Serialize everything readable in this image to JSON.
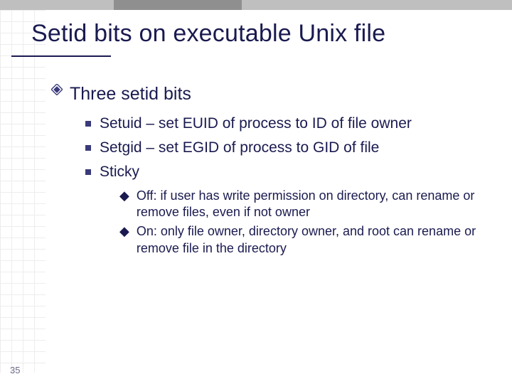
{
  "page_number": "35",
  "title": "Setid bits on executable Unix file",
  "level1": {
    "heading": "Three setid bits"
  },
  "level2": [
    {
      "text": "Setuid – set EUID of process to ID of file owner"
    },
    {
      "text": "Setgid – set EGID of process to GID of file"
    },
    {
      "text": "Sticky"
    }
  ],
  "level3": [
    {
      "text": "Off: if user has write permission on directory, can rename or remove files, even if not owner"
    },
    {
      "text": "On: only file owner, directory owner, and root can rename or remove file in the directory"
    }
  ]
}
